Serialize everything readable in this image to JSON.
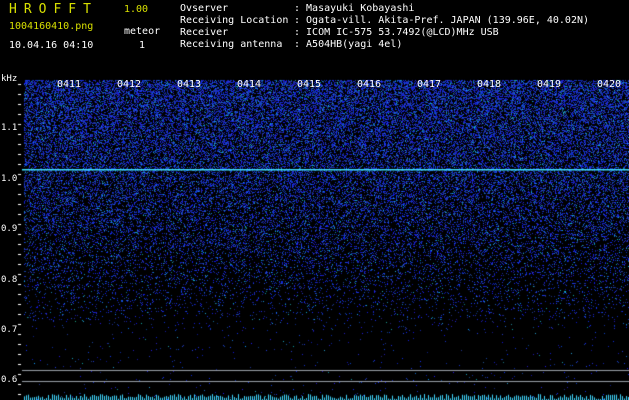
{
  "header": {
    "app_name": "HROFFT",
    "app_version": "1.00",
    "file_name": "1004160410.png",
    "meteor_label": "meteor",
    "datetime": "10.04.16 04:10",
    "meteor_count": "1",
    "info": [
      {
        "key": "Ovserver",
        "value": ": Masayuki Kobayashi"
      },
      {
        "key": "Receiving Location",
        "value": ": Ogata-vill. Akita-Pref. JAPAN (139.96E, 40.02N)"
      },
      {
        "key": "Receiver",
        "value": ": ICOM IC-575 53.7492(@LCD)MHz USB"
      },
      {
        "key": "Receiving antenna",
        "value": ": A504HB(yagi 4el)"
      }
    ]
  },
  "axis": {
    "unit": "kHz",
    "y_ticks": [
      "1.1",
      "1.0",
      "0.9",
      "0.8",
      "0.7",
      "0.6"
    ],
    "x_ticks": [
      "0411",
      "0412",
      "0413",
      "0414",
      "0415",
      "0416",
      "0417",
      "0418",
      "0419",
      "0420"
    ]
  },
  "colors": {
    "background": "#000000",
    "header_yellow": "#d8e000",
    "noise_blue": "#1a3cff",
    "carrier_line": "#40e0ff"
  }
}
